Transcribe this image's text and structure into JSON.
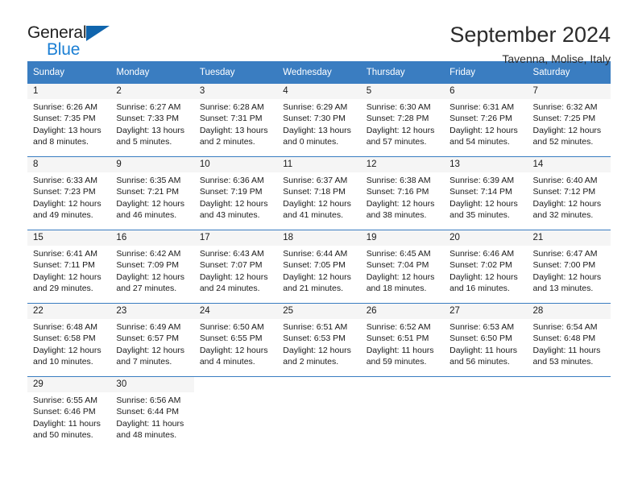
{
  "brand": {
    "name_dark": "General",
    "name_blue": "Blue",
    "accent_color": "#1b7fd4",
    "header_color": "#3a7dc1"
  },
  "header": {
    "title": "September 2024",
    "subtitle": "Tavenna, Molise, Italy"
  },
  "calendar": {
    "weekday_headers": [
      "Sunday",
      "Monday",
      "Tuesday",
      "Wednesday",
      "Thursday",
      "Friday",
      "Saturday"
    ],
    "weeks": [
      [
        {
          "day": "1",
          "sunrise": "Sunrise: 6:26 AM",
          "sunset": "Sunset: 7:35 PM",
          "daylight": "Daylight: 13 hours and 8 minutes."
        },
        {
          "day": "2",
          "sunrise": "Sunrise: 6:27 AM",
          "sunset": "Sunset: 7:33 PM",
          "daylight": "Daylight: 13 hours and 5 minutes."
        },
        {
          "day": "3",
          "sunrise": "Sunrise: 6:28 AM",
          "sunset": "Sunset: 7:31 PM",
          "daylight": "Daylight: 13 hours and 2 minutes."
        },
        {
          "day": "4",
          "sunrise": "Sunrise: 6:29 AM",
          "sunset": "Sunset: 7:30 PM",
          "daylight": "Daylight: 13 hours and 0 minutes."
        },
        {
          "day": "5",
          "sunrise": "Sunrise: 6:30 AM",
          "sunset": "Sunset: 7:28 PM",
          "daylight": "Daylight: 12 hours and 57 minutes."
        },
        {
          "day": "6",
          "sunrise": "Sunrise: 6:31 AM",
          "sunset": "Sunset: 7:26 PM",
          "daylight": "Daylight: 12 hours and 54 minutes."
        },
        {
          "day": "7",
          "sunrise": "Sunrise: 6:32 AM",
          "sunset": "Sunset: 7:25 PM",
          "daylight": "Daylight: 12 hours and 52 minutes."
        }
      ],
      [
        {
          "day": "8",
          "sunrise": "Sunrise: 6:33 AM",
          "sunset": "Sunset: 7:23 PM",
          "daylight": "Daylight: 12 hours and 49 minutes."
        },
        {
          "day": "9",
          "sunrise": "Sunrise: 6:35 AM",
          "sunset": "Sunset: 7:21 PM",
          "daylight": "Daylight: 12 hours and 46 minutes."
        },
        {
          "day": "10",
          "sunrise": "Sunrise: 6:36 AM",
          "sunset": "Sunset: 7:19 PM",
          "daylight": "Daylight: 12 hours and 43 minutes."
        },
        {
          "day": "11",
          "sunrise": "Sunrise: 6:37 AM",
          "sunset": "Sunset: 7:18 PM",
          "daylight": "Daylight: 12 hours and 41 minutes."
        },
        {
          "day": "12",
          "sunrise": "Sunrise: 6:38 AM",
          "sunset": "Sunset: 7:16 PM",
          "daylight": "Daylight: 12 hours and 38 minutes."
        },
        {
          "day": "13",
          "sunrise": "Sunrise: 6:39 AM",
          "sunset": "Sunset: 7:14 PM",
          "daylight": "Daylight: 12 hours and 35 minutes."
        },
        {
          "day": "14",
          "sunrise": "Sunrise: 6:40 AM",
          "sunset": "Sunset: 7:12 PM",
          "daylight": "Daylight: 12 hours and 32 minutes."
        }
      ],
      [
        {
          "day": "15",
          "sunrise": "Sunrise: 6:41 AM",
          "sunset": "Sunset: 7:11 PM",
          "daylight": "Daylight: 12 hours and 29 minutes."
        },
        {
          "day": "16",
          "sunrise": "Sunrise: 6:42 AM",
          "sunset": "Sunset: 7:09 PM",
          "daylight": "Daylight: 12 hours and 27 minutes."
        },
        {
          "day": "17",
          "sunrise": "Sunrise: 6:43 AM",
          "sunset": "Sunset: 7:07 PM",
          "daylight": "Daylight: 12 hours and 24 minutes."
        },
        {
          "day": "18",
          "sunrise": "Sunrise: 6:44 AM",
          "sunset": "Sunset: 7:05 PM",
          "daylight": "Daylight: 12 hours and 21 minutes."
        },
        {
          "day": "19",
          "sunrise": "Sunrise: 6:45 AM",
          "sunset": "Sunset: 7:04 PM",
          "daylight": "Daylight: 12 hours and 18 minutes."
        },
        {
          "day": "20",
          "sunrise": "Sunrise: 6:46 AM",
          "sunset": "Sunset: 7:02 PM",
          "daylight": "Daylight: 12 hours and 16 minutes."
        },
        {
          "day": "21",
          "sunrise": "Sunrise: 6:47 AM",
          "sunset": "Sunset: 7:00 PM",
          "daylight": "Daylight: 12 hours and 13 minutes."
        }
      ],
      [
        {
          "day": "22",
          "sunrise": "Sunrise: 6:48 AM",
          "sunset": "Sunset: 6:58 PM",
          "daylight": "Daylight: 12 hours and 10 minutes."
        },
        {
          "day": "23",
          "sunrise": "Sunrise: 6:49 AM",
          "sunset": "Sunset: 6:57 PM",
          "daylight": "Daylight: 12 hours and 7 minutes."
        },
        {
          "day": "24",
          "sunrise": "Sunrise: 6:50 AM",
          "sunset": "Sunset: 6:55 PM",
          "daylight": "Daylight: 12 hours and 4 minutes."
        },
        {
          "day": "25",
          "sunrise": "Sunrise: 6:51 AM",
          "sunset": "Sunset: 6:53 PM",
          "daylight": "Daylight: 12 hours and 2 minutes."
        },
        {
          "day": "26",
          "sunrise": "Sunrise: 6:52 AM",
          "sunset": "Sunset: 6:51 PM",
          "daylight": "Daylight: 11 hours and 59 minutes."
        },
        {
          "day": "27",
          "sunrise": "Sunrise: 6:53 AM",
          "sunset": "Sunset: 6:50 PM",
          "daylight": "Daylight: 11 hours and 56 minutes."
        },
        {
          "day": "28",
          "sunrise": "Sunrise: 6:54 AM",
          "sunset": "Sunset: 6:48 PM",
          "daylight": "Daylight: 11 hours and 53 minutes."
        }
      ],
      [
        {
          "day": "29",
          "sunrise": "Sunrise: 6:55 AM",
          "sunset": "Sunset: 6:46 PM",
          "daylight": "Daylight: 11 hours and 50 minutes."
        },
        {
          "day": "30",
          "sunrise": "Sunrise: 6:56 AM",
          "sunset": "Sunset: 6:44 PM",
          "daylight": "Daylight: 11 hours and 48 minutes."
        },
        {
          "day": "",
          "sunrise": "",
          "sunset": "",
          "daylight": ""
        },
        {
          "day": "",
          "sunrise": "",
          "sunset": "",
          "daylight": ""
        },
        {
          "day": "",
          "sunrise": "",
          "sunset": "",
          "daylight": ""
        },
        {
          "day": "",
          "sunrise": "",
          "sunset": "",
          "daylight": ""
        },
        {
          "day": "",
          "sunrise": "",
          "sunset": "",
          "daylight": ""
        }
      ]
    ]
  }
}
